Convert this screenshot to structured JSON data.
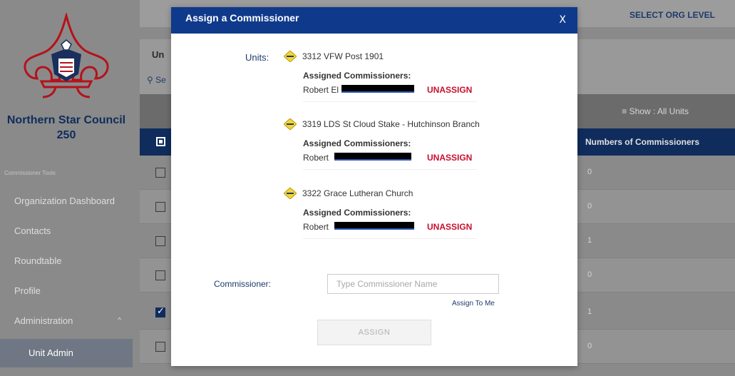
{
  "sidebar": {
    "council_name": "Northern Star Council",
    "council_number": "250",
    "section_label": "Commissioner Tools",
    "items": [
      {
        "label": "Organization Dashboard"
      },
      {
        "label": "Contacts"
      },
      {
        "label": "Roundtable"
      },
      {
        "label": "Profile"
      },
      {
        "label": "Administration"
      },
      {
        "label": "Unit Admin"
      }
    ]
  },
  "main": {
    "select_org_label": "SELECT ORG LEVEL",
    "partial_text": "Un",
    "search_partial": "Se",
    "show_units_label": "Show : All Units",
    "column_numbers_of_commissioners": "Numbers of Commissioners",
    "rows": [
      {
        "count": "0",
        "checked": false
      },
      {
        "count": "0",
        "checked": false
      },
      {
        "count": "1",
        "checked": false
      },
      {
        "count": "0",
        "checked": false
      },
      {
        "count": "1",
        "checked": true
      },
      {
        "count": "0",
        "checked": false
      }
    ]
  },
  "modal": {
    "title": "Assign a Commissioner",
    "close_label": "X",
    "units_label": "Units:",
    "assigned_label": "Assigned Commissioners:",
    "unassign_label": "UNASSIGN",
    "units": [
      {
        "name": "3312 VFW Post 1901",
        "commissioner_prefix": "Robert El"
      },
      {
        "name": "3319 LDS St Cloud Stake - Hutchinson Branch",
        "commissioner_prefix": "Robert"
      },
      {
        "name": "3322 Grace Lutheran Church",
        "commissioner_prefix": "Robert"
      }
    ],
    "commissioner_label": "Commissioner:",
    "commissioner_placeholder": "Type Commissioner Name",
    "assign_to_me_label": "Assign To Me",
    "assign_button_label": "ASSIGN"
  },
  "colors": {
    "navy": "#0f2c5c",
    "modal_header": "#0f3a8c",
    "unassign_red": "#c8102e",
    "unit_diamond": "#f2d43a"
  }
}
